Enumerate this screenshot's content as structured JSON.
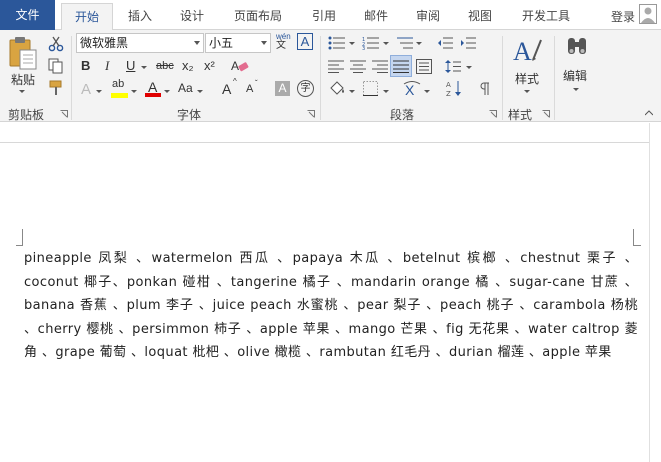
{
  "tabs": [
    {
      "label": "文件"
    },
    {
      "label": "开始"
    },
    {
      "label": "插入"
    },
    {
      "label": "设计"
    },
    {
      "label": "页面布局"
    },
    {
      "label": "引用"
    },
    {
      "label": "邮件"
    },
    {
      "label": "审阅"
    },
    {
      "label": "视图"
    },
    {
      "label": "开发工具"
    }
  ],
  "account": {
    "login_label": "登录"
  },
  "clipboard": {
    "paste_label": "粘贴",
    "group_label": "剪贴板"
  },
  "font": {
    "font_name": "微软雅黑",
    "font_size": "小五",
    "group_label": "字体",
    "bold": "B",
    "italic": "I",
    "underline": "U",
    "strikethrough": "abc",
    "subscript": "x₂",
    "superscript": "x²",
    "text_effects": "A",
    "grow": "A",
    "shrink": "A",
    "case": "Aa",
    "char_shading": "A",
    "phonetic": "wén",
    "enclose": "字",
    "char_border": "A",
    "highlight": "ab",
    "font_color": "A"
  },
  "paragraph": {
    "group_label": "段落"
  },
  "styles": {
    "button_label": "样式",
    "group_label": "样式"
  },
  "editing": {
    "button_label": "编辑"
  },
  "document": {
    "body_text": "pineapple 凤梨 、watermelon 西瓜 、papaya 木瓜 、betelnut 槟榔 、chestnut 栗子 、coconut 椰子、ponkan 碰柑 、tangerine 橘子 、mandarin orange 橘 、sugar-cane 甘蔗 、banana 香蕉 、plum 李子 、juice peach 水蜜桃 、pear 梨子 、peach 桃子 、carambola 杨桃 、cherry 樱桃 、persimmon 柿子 、apple 苹果 、mango 芒果 、fig 无花果 、water caltrop 菱角 、grape 葡萄 、loquat 枇杷 、olive 橄榄 、rambutan 红毛丹 、durian 榴莲 、apple 苹果"
  },
  "colors": {
    "file_tab_bg": "#2b579a",
    "accent": "#2b579a",
    "ribbon_bg": "#f3f3f3",
    "highlight_yellow": "#ffff00",
    "font_color_red": "#e00000"
  }
}
